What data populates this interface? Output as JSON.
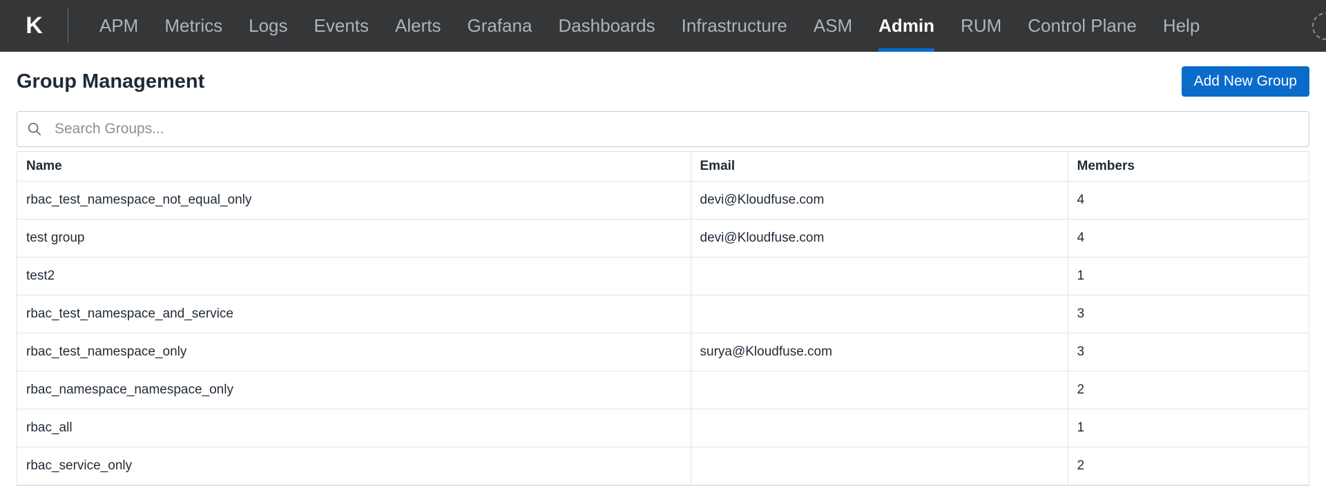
{
  "app": {
    "logo": "K"
  },
  "nav": {
    "items": [
      {
        "label": "APM",
        "active": false
      },
      {
        "label": "Metrics",
        "active": false
      },
      {
        "label": "Logs",
        "active": false
      },
      {
        "label": "Events",
        "active": false
      },
      {
        "label": "Alerts",
        "active": false
      },
      {
        "label": "Grafana",
        "active": false
      },
      {
        "label": "Dashboards",
        "active": false
      },
      {
        "label": "Infrastructure",
        "active": false
      },
      {
        "label": "ASM",
        "active": false
      },
      {
        "label": "Admin",
        "active": true
      },
      {
        "label": "RUM",
        "active": false
      },
      {
        "label": "Control Plane",
        "active": false
      },
      {
        "label": "Help",
        "active": false
      }
    ]
  },
  "page": {
    "title": "Group Management",
    "add_button_label": "Add New Group"
  },
  "search": {
    "placeholder": "Search Groups...",
    "value": "",
    "icon": "search-icon"
  },
  "table": {
    "columns": [
      "Name",
      "Email",
      "Members"
    ],
    "rows": [
      {
        "name": "rbac_test_namespace_not_equal_only",
        "email": "devi@Kloudfuse.com",
        "members": "4"
      },
      {
        "name": "test group",
        "email": "devi@Kloudfuse.com",
        "members": "4"
      },
      {
        "name": "test2",
        "email": "",
        "members": "1"
      },
      {
        "name": "rbac_test_namespace_and_service",
        "email": "",
        "members": "3"
      },
      {
        "name": "rbac_test_namespace_only",
        "email": "surya@Kloudfuse.com",
        "members": "3"
      },
      {
        "name": "rbac_namespace_namespace_only",
        "email": "",
        "members": "2"
      },
      {
        "name": "rbac_all",
        "email": "",
        "members": "1"
      },
      {
        "name": "rbac_service_only",
        "email": "",
        "members": "2"
      }
    ]
  },
  "colors": {
    "topbar": "#343638",
    "accent": "#0b6bcb"
  }
}
